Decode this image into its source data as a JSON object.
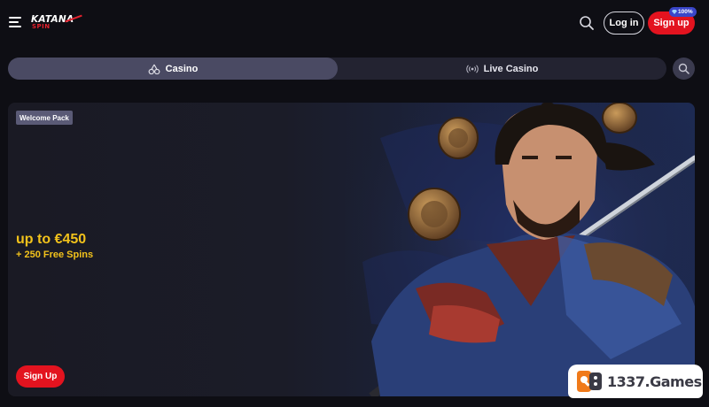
{
  "header": {
    "logo_text_top": "KATANA",
    "logo_text_bottom": "SPIN",
    "login_label": "Log in",
    "signup_label": "Sign up",
    "signup_badge": "100%"
  },
  "tabs": [
    {
      "label": "Casino",
      "icon": "cherries-icon",
      "active": true
    },
    {
      "label": "Live Casino",
      "icon": "live-broadcast-icon",
      "active": false
    }
  ],
  "banner": {
    "tag": "Welcome Pack",
    "headline": "up to €450",
    "subline": "+ 250 Free Spins",
    "cta_label": "Sign Up"
  },
  "watermark": {
    "text": "1337.Games"
  },
  "colors": {
    "accent_red": "#e3131f",
    "gold": "#f2c21b",
    "tab_active": "#4a4a63",
    "background": "#0e0e14"
  }
}
